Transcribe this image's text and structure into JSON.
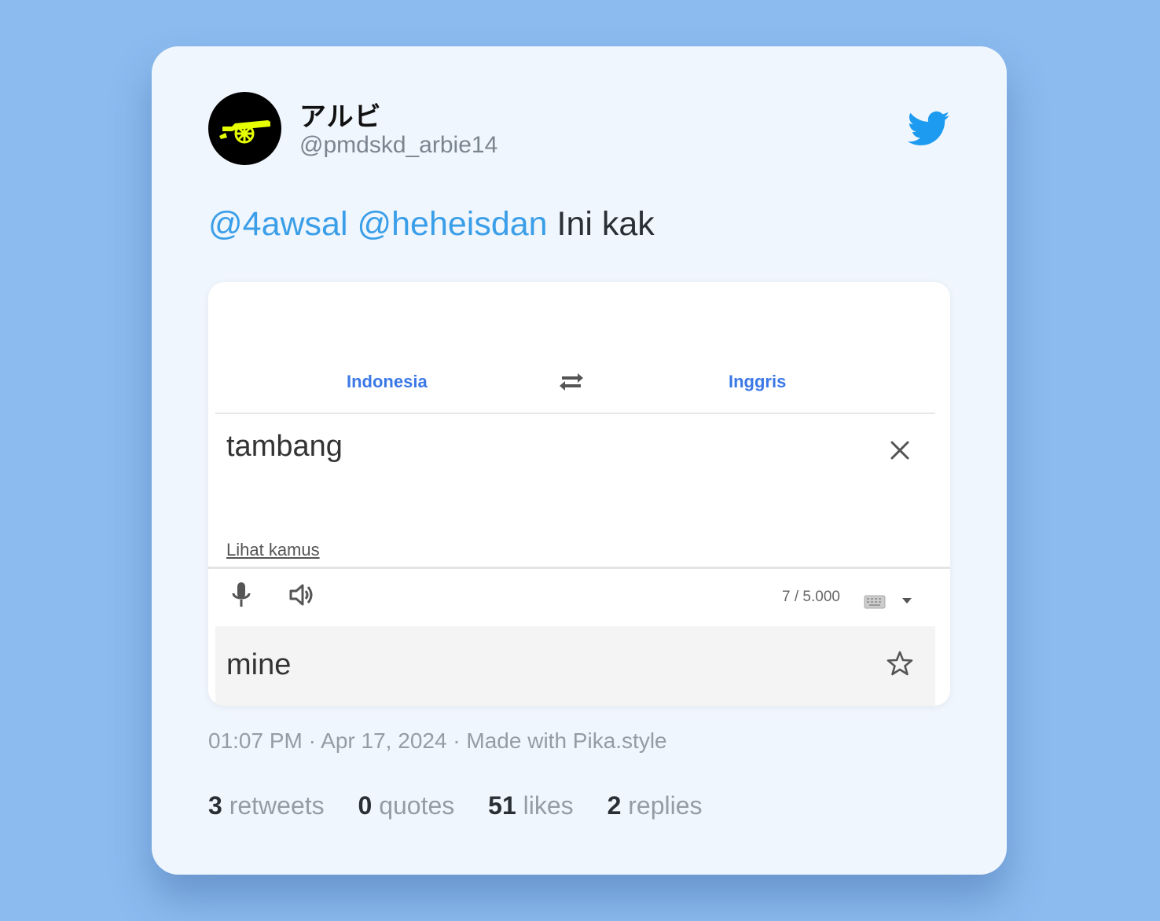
{
  "author": {
    "display_name": "アルビ",
    "handle": "@pmdskd_arbie14",
    "avatar_icon": "cannon-logo-icon"
  },
  "brand_icon": "twitter-bird-icon",
  "tweet": {
    "mention_1": "@4awsal",
    "mention_2": "@heheisdan",
    "text": "Ini kak"
  },
  "translator": {
    "source_language": "Indonesia",
    "target_language": "Inggris",
    "swap_icon": "swap-arrows-icon",
    "source_text": "tambang",
    "dictionary_link": "Lihat kamus",
    "char_count": "7 / 5.000",
    "result_text": "mine"
  },
  "meta": "01:07 PM · Apr 17, 2024 · Made with Pika.style",
  "stats": [
    {
      "count": "3",
      "label": "retweets"
    },
    {
      "count": "0",
      "label": "quotes"
    },
    {
      "count": "51",
      "label": "likes"
    },
    {
      "count": "2",
      "label": "replies"
    }
  ],
  "colors": {
    "background": "#8bbbef",
    "card": "#f0f6fd",
    "mention": "#3a9ee8",
    "twitter_blue": "#1d9bf0",
    "language_blue": "#3b78e7",
    "avatar_accent": "#e6ff00"
  }
}
